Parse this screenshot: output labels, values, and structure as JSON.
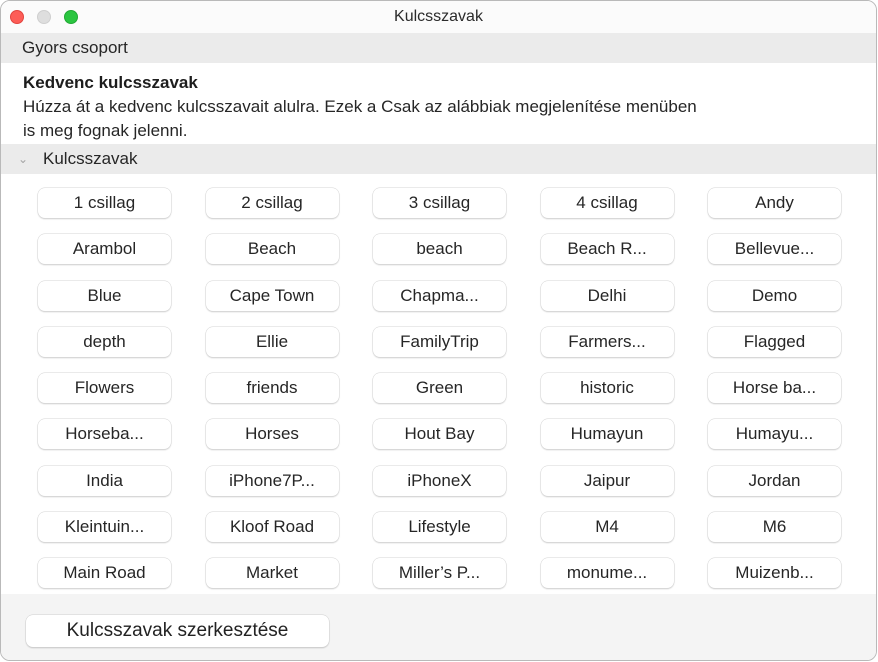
{
  "window": {
    "title": "Kulcsszavak",
    "controls": {
      "close": "close",
      "minimize": "minimize",
      "zoom": "zoom"
    }
  },
  "quick_group": {
    "label": "Gyors csoport"
  },
  "favorites": {
    "title": "Kedvenc kulcsszavak",
    "description_line1": "Húzza át a kedvenc kulcsszavait alulra. Ezek a Csak az alábbiak megjelenítése menüben",
    "description_line2": "is meg fognak jelenni."
  },
  "keywords_section": {
    "label": "Kulcsszavak",
    "expanded": true,
    "items": [
      "1 csillag",
      "2 csillag",
      "3 csillag",
      "4 csillag",
      "Andy",
      "Arambol",
      "Beach",
      "beach",
      "Beach R...",
      "Bellevue...",
      "Blue",
      "Cape Town",
      "Chapma...",
      "Delhi",
      "Demo",
      "depth",
      "Ellie",
      "FamilyTrip",
      "Farmers...",
      "Flagged",
      "Flowers",
      "friends",
      "Green",
      "historic",
      "Horse ba...",
      "Horseba...",
      "Horses",
      "Hout Bay",
      "Humayun",
      "Humayu...",
      "India",
      "iPhone7P...",
      "iPhoneX",
      "Jaipur",
      "Jordan",
      "Kleintuin...",
      "Kloof Road",
      "Lifestyle",
      "M4",
      "M6",
      "Main Road",
      "Market",
      "Miller’s P...",
      "monume...",
      "Muizenb..."
    ]
  },
  "footer": {
    "edit_button_label": "Kulcsszavak szerkesztése"
  }
}
